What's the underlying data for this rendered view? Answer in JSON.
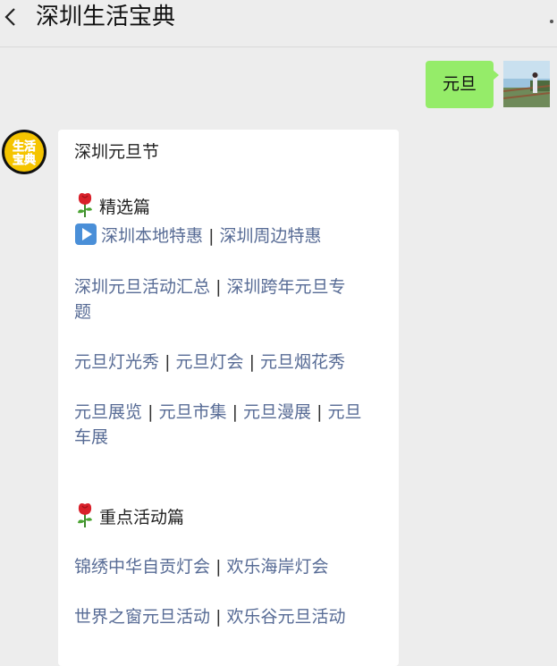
{
  "header": {
    "title": "深圳生活宝典"
  },
  "chat": {
    "sent_message": "元旦",
    "bot_avatar_text": [
      "生活",
      "宝典"
    ],
    "card": {
      "heading": "深圳元旦节",
      "section1_title": "精选篇",
      "row1": {
        "a": "深圳本地特惠",
        "b": "深圳周边特惠"
      },
      "row2": {
        "a": "深圳元旦活动汇总",
        "b1": "深圳跨年元旦专",
        "b2": "题"
      },
      "row3": {
        "a": "元旦灯光秀",
        "b": "元旦灯会",
        "c": "元旦烟花秀"
      },
      "row4": {
        "a": "元旦展览",
        "b": "元旦市集",
        "c": "元旦漫展",
        "d1": "元旦",
        "d2": "车展"
      },
      "section2_title": "重点活动篇",
      "row5": {
        "a": "锦绣中华自贡灯会",
        "b": "欢乐海岸灯会"
      },
      "row6": {
        "a": "世界之窗元旦活动",
        "b": "欢乐谷元旦活动"
      },
      "separator": "|"
    }
  }
}
